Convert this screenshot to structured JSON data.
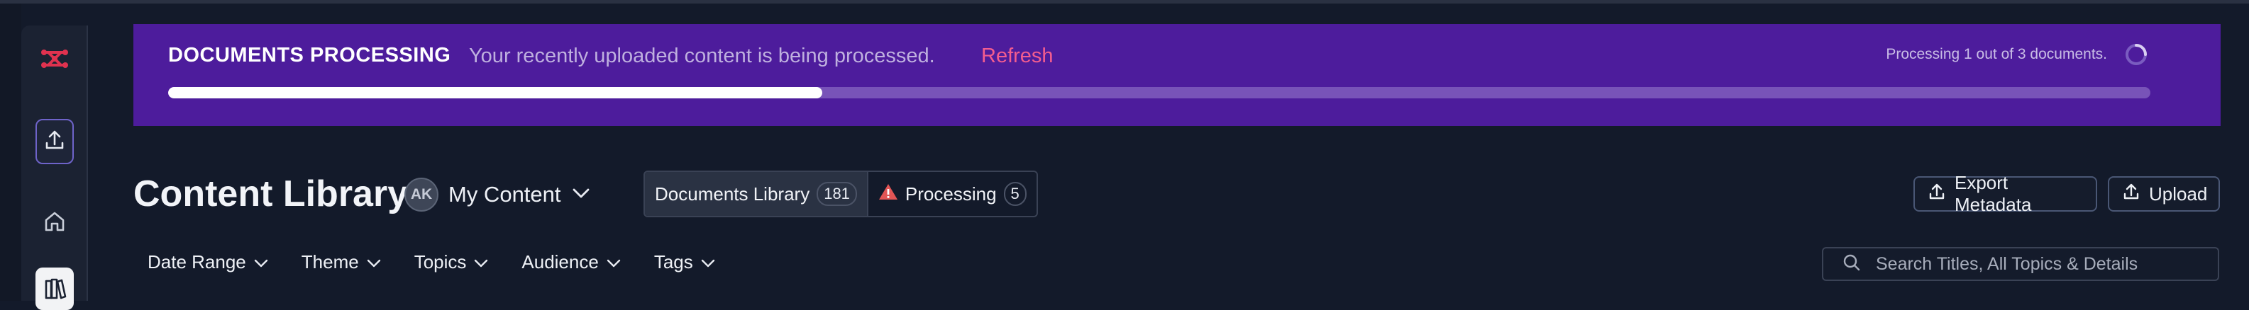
{
  "banner": {
    "title": "DOCUMENTS PROCESSING",
    "message": "Your recently uploaded content is being processed.",
    "refresh_label": "Refresh",
    "status_text": "Processing 1 out of 3 documents.",
    "progress_fraction": 0.33
  },
  "sidebar": {
    "items": [
      {
        "icon": "logo-icon"
      },
      {
        "icon": "upload-icon"
      },
      {
        "icon": "home-icon"
      },
      {
        "icon": "library-icon"
      }
    ]
  },
  "header": {
    "title": "Content Library",
    "owner": {
      "initials": "AK",
      "label": "My Content"
    },
    "tabs": [
      {
        "label": "Documents Library",
        "count": "181"
      },
      {
        "label": "Processing",
        "count": "5"
      }
    ],
    "export_label": "Export Metadata",
    "upload_label": "Upload"
  },
  "filters": {
    "items": [
      "Date Range",
      "Theme",
      "Topics",
      "Audience",
      "Tags"
    ]
  },
  "search": {
    "placeholder": "Search Titles, All Topics & Details"
  },
  "colors": {
    "banner_bg": "#4d1c9c",
    "refresh": "#f35d8f",
    "background": "#131a2a",
    "warning": "#e25555"
  }
}
